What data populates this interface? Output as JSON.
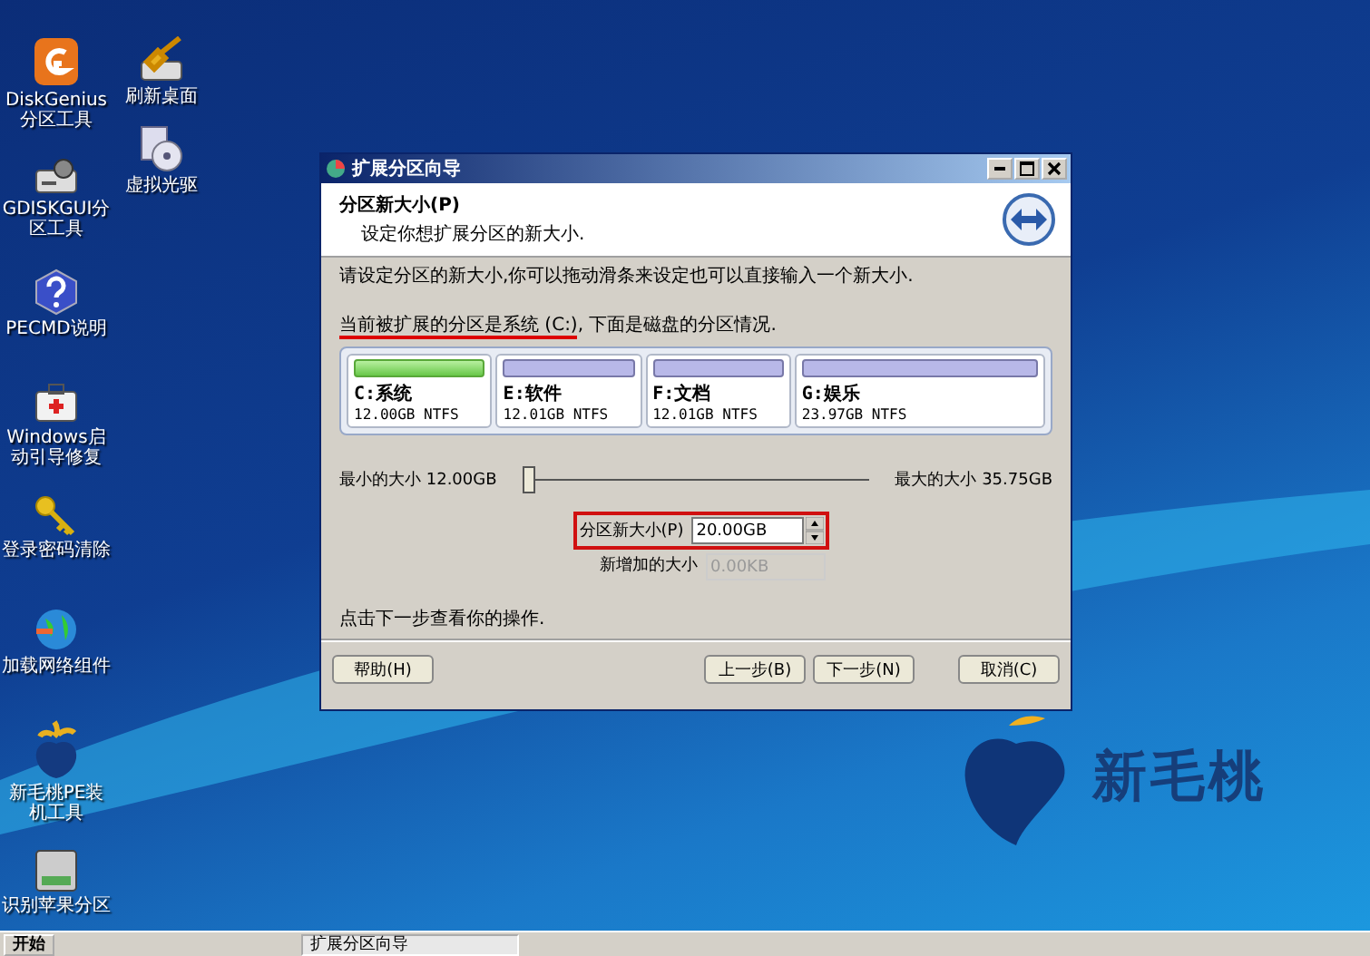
{
  "desktop_icon_columns": [
    [
      {
        "label": "DiskGenius分区工具",
        "kind": "disk-genius"
      },
      {
        "label": "GDISKGUI分区工具",
        "kind": "drive-gear"
      },
      {
        "label": "PECMD说明",
        "kind": "help"
      },
      {
        "label": "Windows启动引导修复",
        "kind": "first-aid"
      },
      {
        "label": "登录密码清除",
        "kind": "key"
      },
      {
        "label": "加载网络组件",
        "kind": "globe"
      },
      {
        "label": "新毛桃PE装机工具",
        "kind": "peach"
      },
      {
        "label": "识别苹果分区",
        "kind": "drive"
      }
    ],
    [
      {
        "label": "刷新桌面",
        "kind": "brush"
      },
      {
        "label": "虚拟光驱",
        "kind": "cd"
      }
    ]
  ],
  "wallpaper_logo": "新毛桃",
  "window": {
    "title": "扩展分区向导",
    "header": {
      "title": "分区新大小(P)",
      "subtitle": "设定你想扩展分区的新大小."
    },
    "instruction": "请设定分区的新大小,你可以拖动滑条来设定也可以直接输入一个新大小.",
    "partition_note": {
      "highlighted": "当前被扩展的分区是系统 (C:)",
      "rest": ", 下面是磁盘的分区情况."
    },
    "partitions": [
      {
        "name": "C:系统",
        "size": "12.00GB NTFS",
        "selected": true
      },
      {
        "name": "E:软件",
        "size": "12.01GB NTFS",
        "selected": false
      },
      {
        "name": "F:文档",
        "size": "12.01GB NTFS",
        "selected": false
      },
      {
        "name": "G:娱乐",
        "size": "23.97GB NTFS",
        "selected": false
      }
    ],
    "slider": {
      "min_label": "最小的大小 12.00GB",
      "max_label": "最大的大小 35.75GB",
      "level": 0
    },
    "new_size": {
      "label": "分区新大小(P)",
      "value": "20.00GB"
    },
    "added_size": {
      "label": "新增加的大小",
      "value": "0.00KB",
      "disabled": true
    },
    "footer_text": "点击下一步查看你的操作.",
    "buttons": [
      "帮助(H)",
      "上一步(B)",
      "下一步(N)",
      "取消(C)"
    ]
  },
  "taskbar": {
    "start": "开始",
    "tasks": [
      "扩展分区向导"
    ]
  }
}
